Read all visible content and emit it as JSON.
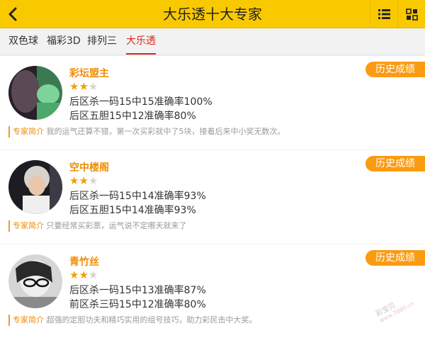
{
  "header": {
    "title": "大乐透十大专家"
  },
  "tabs": [
    {
      "label": "双色球",
      "active": false
    },
    {
      "label": "福彩3D",
      "active": false
    },
    {
      "label": "排列三",
      "active": false
    },
    {
      "label": "大乐透",
      "active": true
    }
  ],
  "experts": [
    {
      "name": "彩坛盟主",
      "rating": 2,
      "rating_max": 3,
      "stats": [
        "后区杀一码15中15准确率100%",
        "后区五胆15中12准确率80%"
      ],
      "intro_label": "专家简介",
      "intro_text": "我的运气还算不错，第一次买彩就中了5块，接着后来中小奖无数次。",
      "history_label": "历史成绩"
    },
    {
      "name": "空中楼阁",
      "rating": 2,
      "rating_max": 3,
      "stats": [
        "后区杀一码15中14准确率93%",
        "后区五胆15中14准确率93%"
      ],
      "intro_label": "专家简介",
      "intro_text": "只要经常买彩票，运气说不定哪天就来了",
      "history_label": "历史成绩"
    },
    {
      "name": "青竹丝",
      "rating": 2,
      "rating_max": 3,
      "stats": [
        "后区杀一码15中13准确率87%",
        "前区杀三码15中12准确率80%"
      ],
      "intro_label": "专家简介",
      "intro_text": "超强的定胆功夫和精巧实用的组号技巧，助力彩民击中大奖。",
      "history_label": "历史成绩"
    }
  ],
  "watermark": {
    "line1": "彩宝贝",
    "line2": "www.7860.cn"
  },
  "colors": {
    "header_bg": "#f9c900",
    "accent_orange": "#fb9b12",
    "name_orange": "#f08c00",
    "active_tab_red": "#e0251b"
  },
  "icons": {
    "back": "chevron-left-icon",
    "list": "list-icon",
    "grid": "grid-icon"
  }
}
